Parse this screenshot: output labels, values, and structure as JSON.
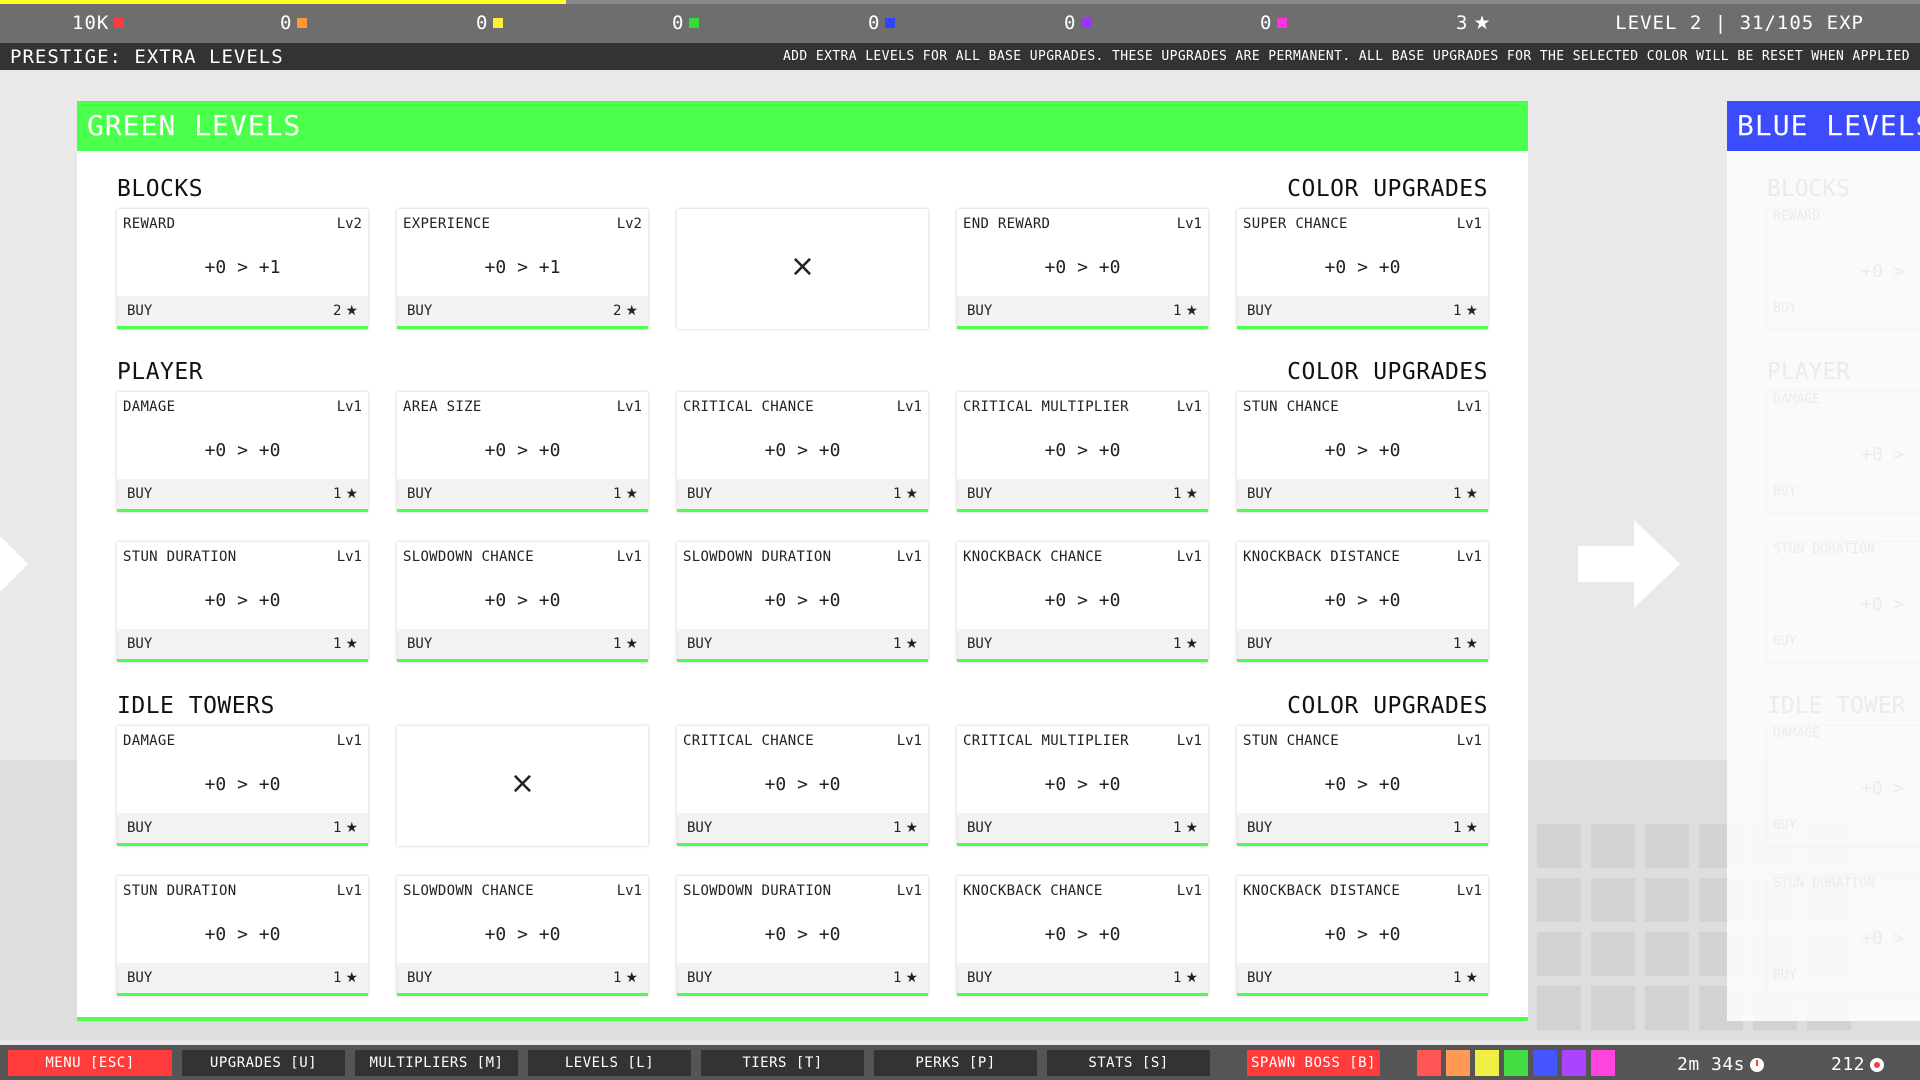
{
  "resources": [
    {
      "value": "10K",
      "color": "#ff3b3b"
    },
    {
      "value": "0",
      "color": "#ff9933"
    },
    {
      "value": "0",
      "color": "#ffee33"
    },
    {
      "value": "0",
      "color": "#33dd33"
    },
    {
      "value": "0",
      "color": "#3344ff"
    },
    {
      "value": "0",
      "color": "#9933ff"
    },
    {
      "value": "0",
      "color": "#ff33dd"
    }
  ],
  "stars": "3",
  "level_info": "LEVEL 2 | 31/105 EXP",
  "xp_progress": 0.295,
  "prestige": {
    "title": "PRESTIGE: EXTRA LEVELS",
    "description": "ADD EXTRA LEVELS FOR ALL BASE UPGRADES. THESE UPGRADES ARE PERMANENT. ALL BASE UPGRADES FOR THE SELECTED COLOR WILL BE RESET WHEN APPLIED"
  },
  "green_panel": {
    "title": "GREEN LEVELS",
    "accent": "#4dff4d",
    "sections": [
      {
        "title": "BLOCKS",
        "right_label": "COLOR UPGRADES",
        "rows": [
          [
            {
              "name": "REWARD",
              "level": "Lv2",
              "value": "+0 > +1",
              "buy": "BUY",
              "cost": "2"
            },
            {
              "name": "EXPERIENCE",
              "level": "Lv2",
              "value": "+0 > +1",
              "buy": "BUY",
              "cost": "2"
            },
            {
              "empty": true,
              "mark": "×"
            },
            {
              "name": "END REWARD",
              "level": "Lv1",
              "value": "+0 > +0",
              "buy": "BUY",
              "cost": "1"
            },
            {
              "name": "SUPER CHANCE",
              "level": "Lv1",
              "value": "+0 > +0",
              "buy": "BUY",
              "cost": "1"
            }
          ]
        ]
      },
      {
        "title": "PLAYER",
        "right_label": "COLOR UPGRADES",
        "rows": [
          [
            {
              "name": "DAMAGE",
              "level": "Lv1",
              "value": "+0 > +0",
              "buy": "BUY",
              "cost": "1"
            },
            {
              "name": "AREA SIZE",
              "level": "Lv1",
              "value": "+0 > +0",
              "buy": "BUY",
              "cost": "1"
            },
            {
              "name": "CRITICAL CHANCE",
              "level": "Lv1",
              "value": "+0 > +0",
              "buy": "BUY",
              "cost": "1"
            },
            {
              "name": "CRITICAL MULTIPLIER",
              "level": "Lv1",
              "value": "+0 > +0",
              "buy": "BUY",
              "cost": "1"
            },
            {
              "name": "STUN CHANCE",
              "level": "Lv1",
              "value": "+0 > +0",
              "buy": "BUY",
              "cost": "1"
            }
          ],
          [
            {
              "name": "STUN DURATION",
              "level": "Lv1",
              "value": "+0 > +0",
              "buy": "BUY",
              "cost": "1"
            },
            {
              "name": "SLOWDOWN CHANCE",
              "level": "Lv1",
              "value": "+0 > +0",
              "buy": "BUY",
              "cost": "1"
            },
            {
              "name": "SLOWDOWN DURATION",
              "level": "Lv1",
              "value": "+0 > +0",
              "buy": "BUY",
              "cost": "1"
            },
            {
              "name": "KNOCKBACK CHANCE",
              "level": "Lv1",
              "value": "+0 > +0",
              "buy": "BUY",
              "cost": "1"
            },
            {
              "name": "KNOCKBACK DISTANCE",
              "level": "Lv1",
              "value": "+0 > +0",
              "buy": "BUY",
              "cost": "1"
            }
          ]
        ]
      },
      {
        "title": "IDLE TOWERS",
        "right_label": "COLOR UPGRADES",
        "rows": [
          [
            {
              "name": "DAMAGE",
              "level": "Lv1",
              "value": "+0 > +0",
              "buy": "BUY",
              "cost": "1"
            },
            {
              "empty": true,
              "mark": "×"
            },
            {
              "name": "CRITICAL CHANCE",
              "level": "Lv1",
              "value": "+0 > +0",
              "buy": "BUY",
              "cost": "1"
            },
            {
              "name": "CRITICAL MULTIPLIER",
              "level": "Lv1",
              "value": "+0 > +0",
              "buy": "BUY",
              "cost": "1"
            },
            {
              "name": "STUN CHANCE",
              "level": "Lv1",
              "value": "+0 > +0",
              "buy": "BUY",
              "cost": "1"
            }
          ],
          [
            {
              "name": "STUN DURATION",
              "level": "Lv1",
              "value": "+0 > +0",
              "buy": "BUY",
              "cost": "1"
            },
            {
              "name": "SLOWDOWN CHANCE",
              "level": "Lv1",
              "value": "+0 > +0",
              "buy": "BUY",
              "cost": "1"
            },
            {
              "name": "SLOWDOWN DURATION",
              "level": "Lv1",
              "value": "+0 > +0",
              "buy": "BUY",
              "cost": "1"
            },
            {
              "name": "KNOCKBACK CHANCE",
              "level": "Lv1",
              "value": "+0 > +0",
              "buy": "BUY",
              "cost": "1"
            },
            {
              "name": "KNOCKBACK DISTANCE",
              "level": "Lv1",
              "value": "+0 > +0",
              "buy": "BUY",
              "cost": "1"
            }
          ]
        ]
      }
    ]
  },
  "blue_panel": {
    "title": "BLUE LEVELS",
    "accent": "#3344ff",
    "ghost_labels": [
      "BLOCKS",
      "REWARD",
      "+0 >",
      "BUY",
      "PLAYER",
      "DAMAGE",
      "+0 >",
      "BUY",
      "STUN DURATION",
      "+0 >",
      "BUY",
      "IDLE TOWER",
      "DAMAGE",
      "+0 >",
      "BUY",
      "STUN DURATION",
      "+0 >",
      "BUY"
    ]
  },
  "nav": {
    "menu": "MENU [ESC]",
    "upgrades": "UPGRADES [U]",
    "multipliers": "MULTIPLIERS [M]",
    "levels": "LEVELS [L]",
    "tiers": "TIERS [T]",
    "perks": "PERKS [P]",
    "stats": "STATS [S]",
    "spawn_boss": "SPAWN BOSS [B]",
    "color_swatches": [
      "#ff5555",
      "#ff9955",
      "#eeee44",
      "#44dd44",
      "#4455ff",
      "#aa44ff",
      "#ff44dd"
    ],
    "timer": "2m 34s",
    "orbs": "212"
  },
  "icons": {
    "star": "star-icon",
    "clock": "clock-icon",
    "orb": "orb-icon",
    "arrow_left": "arrow-left-icon",
    "arrow_right": "arrow-right-icon"
  }
}
